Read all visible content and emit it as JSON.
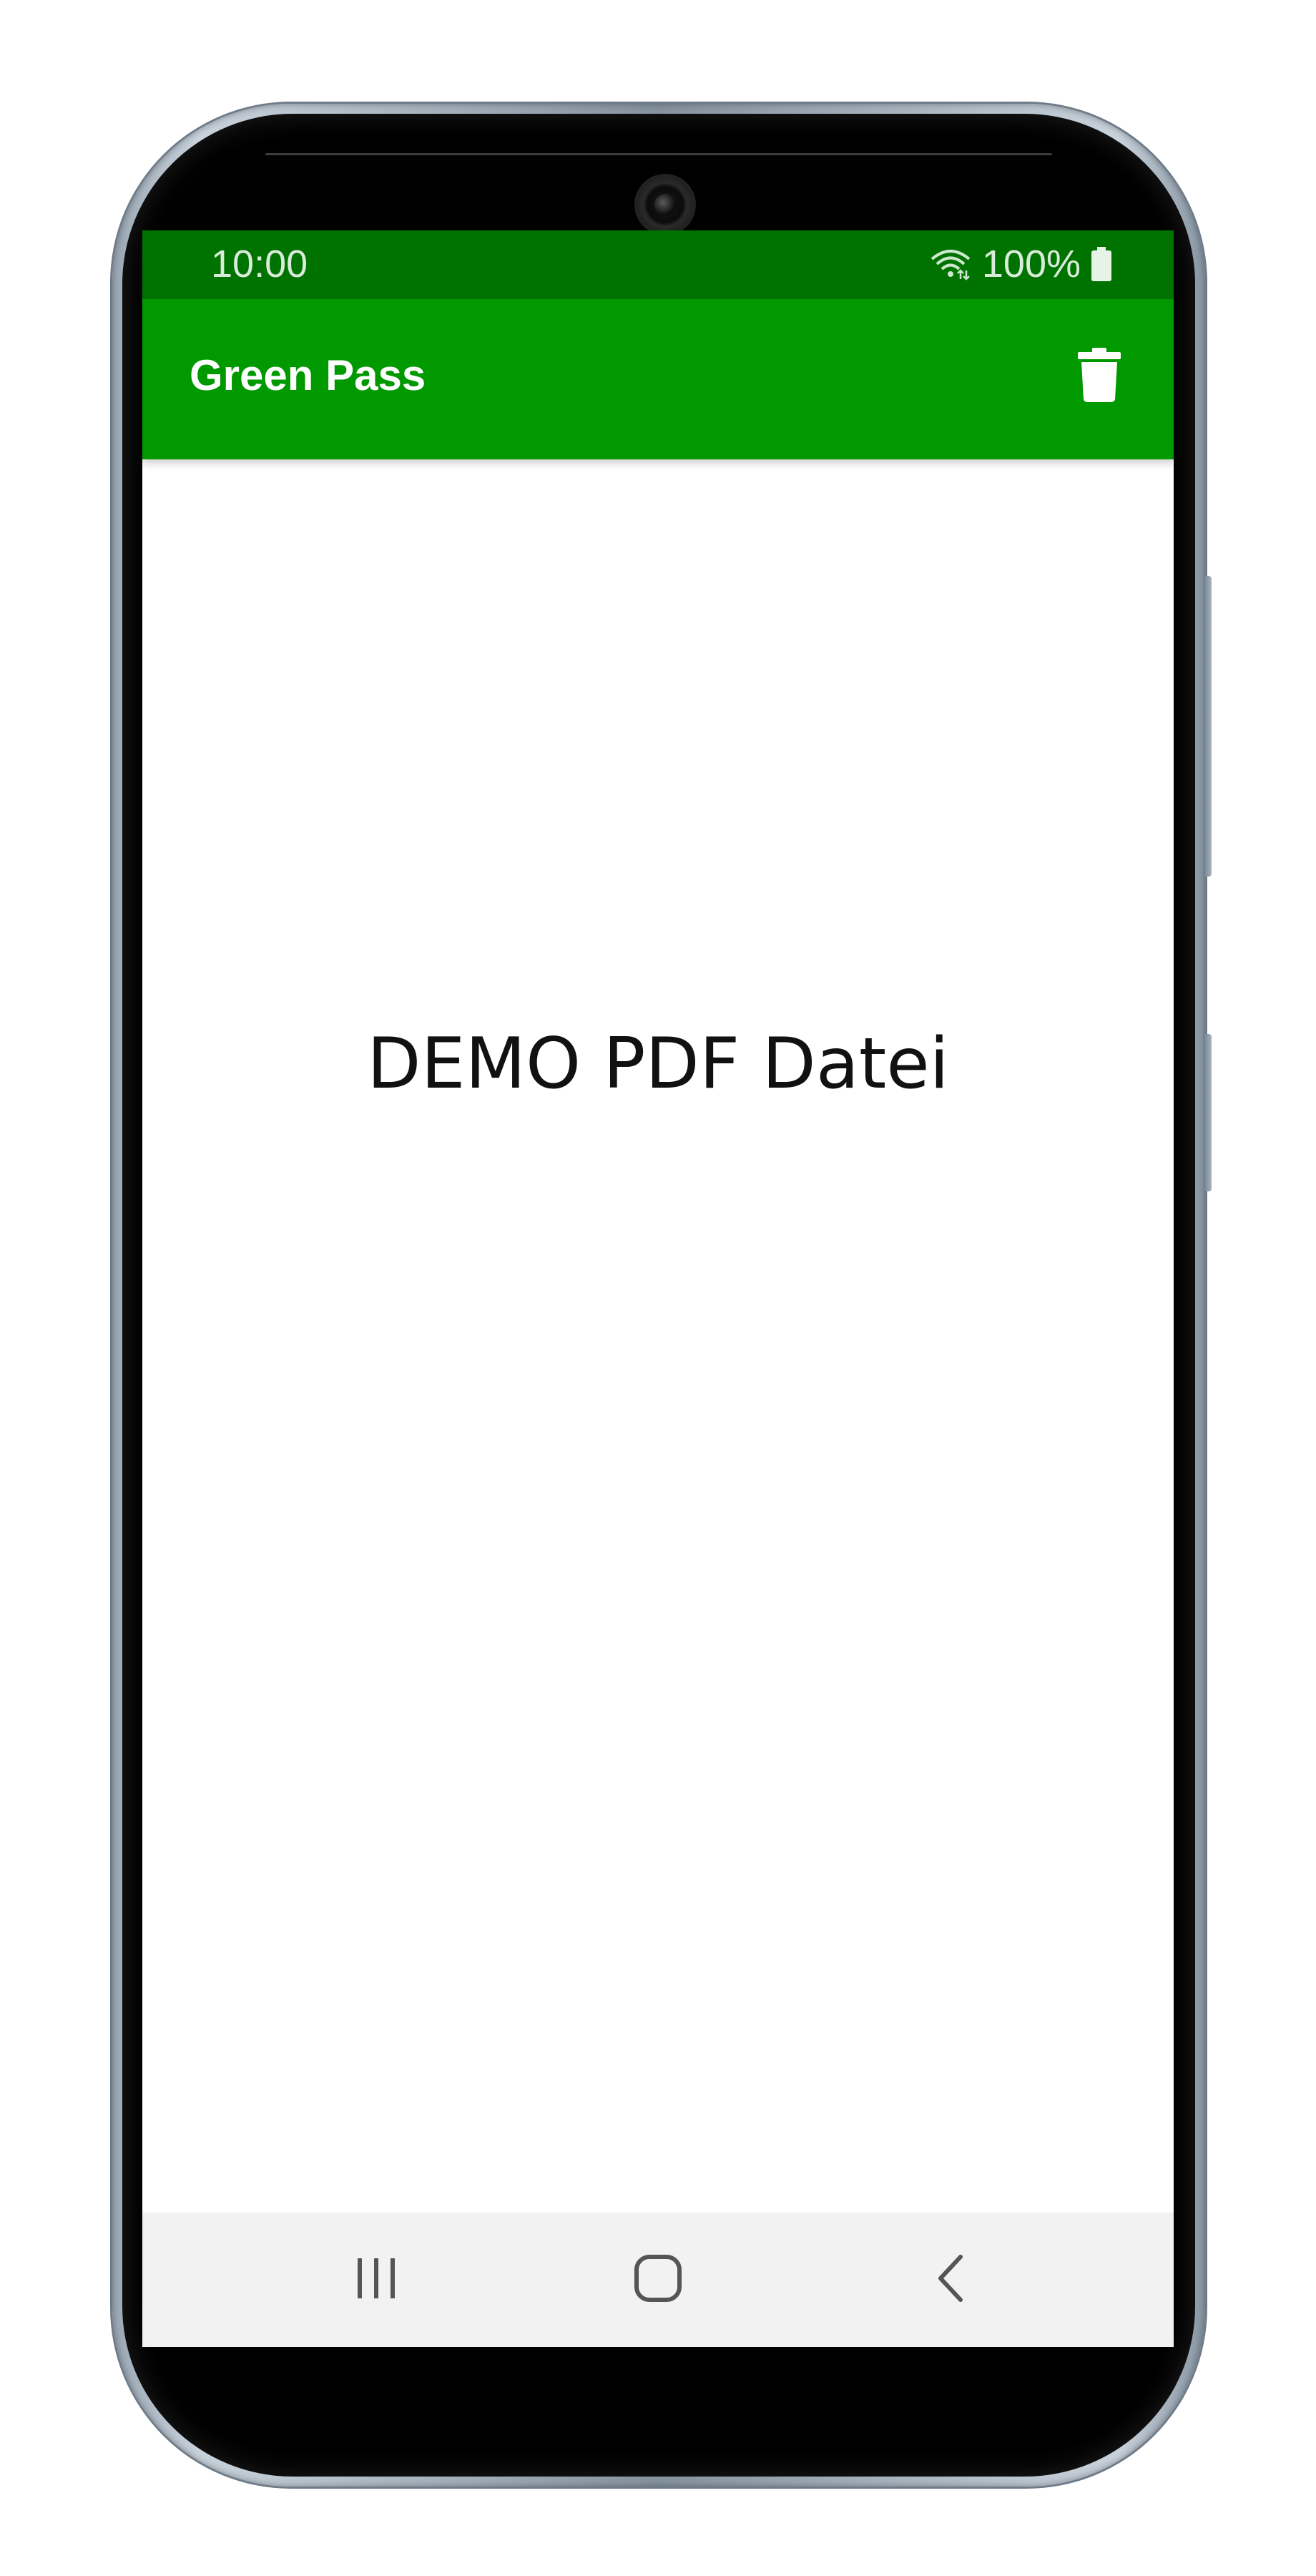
{
  "status_bar": {
    "time": "10:00",
    "battery": "100%",
    "wifi_icon": "wifi-icon",
    "battery_icon": "battery-full-icon"
  },
  "app_bar": {
    "title": "Green Pass",
    "action_icon": "trash-icon"
  },
  "content": {
    "document_text": "DEMO PDF Datei"
  },
  "navigation": {
    "recent_icon": "recent-apps-icon",
    "home_icon": "home-icon",
    "back_icon": "back-icon"
  },
  "colors": {
    "status_bar": "#007200",
    "app_bar": "#009900",
    "nav_bar": "#f2f2f2"
  }
}
